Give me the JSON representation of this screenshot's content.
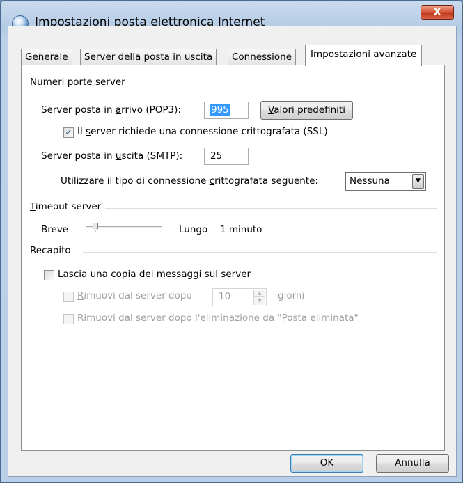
{
  "window": {
    "title": "Impostazioni posta elettronica Internet",
    "close_label": "X"
  },
  "tabs": [
    {
      "label": "Generale",
      "active": false
    },
    {
      "label": "Server della posta in uscita",
      "active": false
    },
    {
      "label": "Connessione",
      "active": false
    },
    {
      "label": "Impostazioni avanzate",
      "active": true
    }
  ],
  "ports_group": {
    "title": "Numeri porte server",
    "incoming_label_before": "Server posta in ",
    "incoming_label_u": "a",
    "incoming_label_after": "rrivo (POP3):",
    "incoming_value": "995",
    "defaults_button_u": "V",
    "defaults_button_rest": "alori predefiniti",
    "ssl_checkbox_checked": true,
    "ssl_label_before": "Il ",
    "ssl_label_u": "s",
    "ssl_label_after": "erver richiede una connessione crittografata (SSL)",
    "outgoing_label_before": "Server posta in ",
    "outgoing_label_u": "u",
    "outgoing_label_after": "scita (SMTP):",
    "outgoing_value": "25",
    "encryption_label_before": "Utilizzare il tipo di connessione ",
    "encryption_label_u": "c",
    "encryption_label_after": "rittografata seguente:",
    "encryption_value": "Nessuna"
  },
  "timeout_group": {
    "title_u": "T",
    "title_rest": "imeout server",
    "short_label": "Breve",
    "long_label": "Lungo",
    "value_label": "1 minuto",
    "slider_level": 0.0
  },
  "delivery_group": {
    "title": "Recapito",
    "leave_copy_checked": false,
    "leave_copy_u": "L",
    "leave_copy_rest": "ascia una copia dei messaggi sul server",
    "remove_after_checked": false,
    "remove_after_u": "R",
    "remove_after_rest": "imuovi dal server dopo",
    "remove_after_days": "10",
    "days_label": "giorni",
    "remove_deleted_checked": false,
    "remove_deleted_before": "Ri",
    "remove_deleted_u": "m",
    "remove_deleted_after": "uovi dal server dopo l'eliminazione da \"Posta eliminata\""
  },
  "footer": {
    "ok_label": "OK",
    "cancel_label": "Annulla"
  }
}
